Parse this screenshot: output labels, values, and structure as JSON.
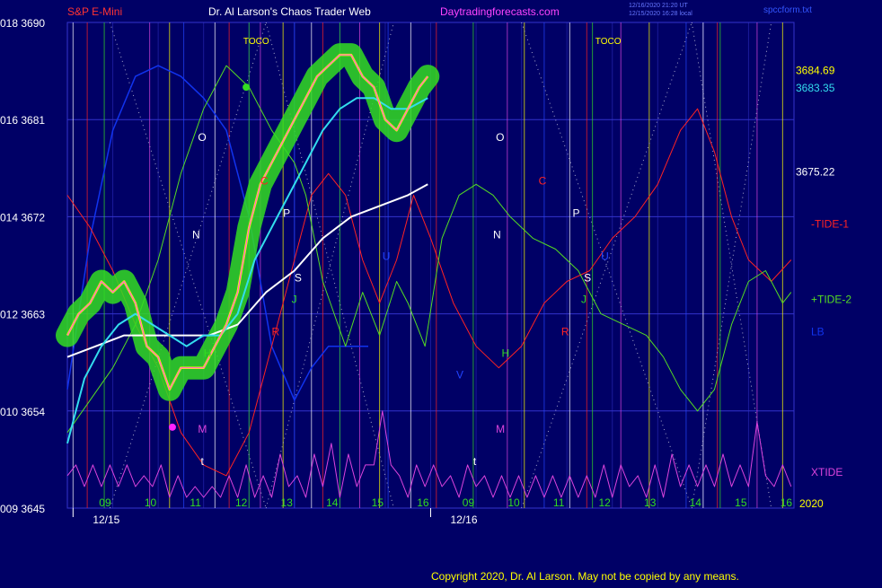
{
  "header": {
    "instrument": "S&P E-Mini",
    "title": "Dr. Al Larson's Chaos Trader Web",
    "site": "Daytradingforecasts.com",
    "timestamp_1": "12/16/2020 21:20 UT",
    "timestamp_2": "12/15/2020 16:28 local",
    "file": "spccform.txt"
  },
  "footer": {
    "copyright": "Copyright 2020, Dr. Al Larson. May not be copied by any means."
  },
  "colors": {
    "background": "#000066",
    "frame": "#3333cc",
    "price": "#ffff00",
    "price_inner": "#ff44ff",
    "glow": "#33dd22",
    "fast_avg": "#33ddee",
    "slow_avg": "#ffffff",
    "tide1": "#ff2222",
    "tide2": "#55dd22",
    "lb": "#1133ee",
    "xtide": "#dd44dd"
  },
  "chart_data": {
    "type": "line",
    "y_axis_left": {
      "ticks": [
        {
          "code": "018",
          "price": "3690"
        },
        {
          "code": "016",
          "price": "3681"
        },
        {
          "code": "014",
          "price": "3672"
        },
        {
          "code": "012",
          "price": "3663"
        },
        {
          "code": "010",
          "price": "3654"
        },
        {
          "code": "009",
          "price": "3645"
        }
      ],
      "range": [
        3645,
        3690
      ]
    },
    "x_axis": {
      "hour_labels": [
        "09",
        "10",
        "11",
        "12",
        "13",
        "14",
        "15",
        "16",
        "09",
        "10",
        "11",
        "12",
        "13",
        "14",
        "15",
        "16"
      ],
      "date_labels": [
        "12/15",
        "12/16"
      ],
      "year": "2020"
    },
    "right_values": {
      "price_last": "3684.69",
      "fast_avg_last": "3683.35",
      "slow_avg_last": "3675.22"
    },
    "series_labels": [
      "-TIDE-1",
      "+TIDE-2",
      "LB",
      "XTIDE"
    ],
    "markers": [
      "TOCO",
      "TOCO"
    ],
    "cycle_letters": [
      {
        "t": "O",
        "c": "#ffffff"
      },
      {
        "t": "N",
        "c": "#ffffff"
      },
      {
        "t": "H",
        "c": "#33dd22"
      },
      {
        "t": "M",
        "c": "#dd44dd"
      },
      {
        "t": "t",
        "c": "#ffffff"
      },
      {
        "t": "C",
        "c": "#ff2222"
      },
      {
        "t": "P",
        "c": "#ffffff"
      },
      {
        "t": "S",
        "c": "#ffffff"
      },
      {
        "t": "J",
        "c": "#33dd22"
      },
      {
        "t": "R",
        "c": "#ff2222"
      },
      {
        "t": "U",
        "c": "#2244ff"
      },
      {
        "t": "V",
        "c": "#2244ff"
      },
      {
        "t": "O",
        "c": "#ffffff"
      },
      {
        "t": "N",
        "c": "#ffffff"
      },
      {
        "t": "H",
        "c": "#33dd22"
      },
      {
        "t": "M",
        "c": "#dd44dd"
      },
      {
        "t": "t",
        "c": "#ffffff"
      },
      {
        "t": "C",
        "c": "#ff2222"
      },
      {
        "t": "P",
        "c": "#ffffff"
      },
      {
        "t": "S",
        "c": "#ffffff"
      },
      {
        "t": "J",
        "c": "#33dd22"
      },
      {
        "t": "R",
        "c": "#ff2222"
      },
      {
        "t": "U",
        "c": "#2244ff"
      }
    ],
    "price_series": [
      [
        0.0,
        3661
      ],
      [
        0.4,
        3663
      ],
      [
        0.8,
        3664
      ],
      [
        1.2,
        3666
      ],
      [
        1.6,
        3665
      ],
      [
        2.0,
        3666
      ],
      [
        2.4,
        3664
      ],
      [
        2.8,
        3660
      ],
      [
        3.2,
        3659
      ],
      [
        3.6,
        3656
      ],
      [
        4.0,
        3658
      ],
      [
        4.4,
        3658
      ],
      [
        4.8,
        3658
      ],
      [
        5.2,
        3660
      ],
      [
        5.6,
        3662
      ],
      [
        6.0,
        3665
      ],
      [
        6.4,
        3671
      ],
      [
        6.8,
        3675
      ],
      [
        7.2,
        3677
      ],
      [
        7.6,
        3679
      ],
      [
        8.0,
        3681
      ],
      [
        8.4,
        3683
      ],
      [
        8.8,
        3685
      ],
      [
        9.2,
        3686
      ],
      [
        9.6,
        3687
      ],
      [
        10.0,
        3687
      ],
      [
        10.4,
        3685
      ],
      [
        10.8,
        3684
      ],
      [
        11.2,
        3681
      ],
      [
        11.6,
        3680
      ],
      [
        12.0,
        3682
      ],
      [
        12.4,
        3684
      ],
      [
        12.7,
        3685
      ]
    ],
    "fast_avg": [
      [
        0.0,
        3651
      ],
      [
        0.6,
        3657
      ],
      [
        1.2,
        3660
      ],
      [
        1.8,
        3662
      ],
      [
        2.4,
        3663
      ],
      [
        3.0,
        3662
      ],
      [
        3.6,
        3661
      ],
      [
        4.2,
        3660
      ],
      [
        4.8,
        3661
      ],
      [
        5.4,
        3661
      ],
      [
        6.0,
        3663
      ],
      [
        6.6,
        3668
      ],
      [
        7.2,
        3671
      ],
      [
        7.8,
        3674
      ],
      [
        8.4,
        3677
      ],
      [
        9.0,
        3680
      ],
      [
        9.6,
        3682
      ],
      [
        10.2,
        3683
      ],
      [
        10.8,
        3683
      ],
      [
        11.4,
        3682
      ],
      [
        12.0,
        3682
      ],
      [
        12.7,
        3683
      ]
    ],
    "slow_avg": [
      [
        0.0,
        3659
      ],
      [
        1.0,
        3660
      ],
      [
        2.0,
        3661
      ],
      [
        3.0,
        3661
      ],
      [
        4.0,
        3661
      ],
      [
        5.0,
        3661
      ],
      [
        6.0,
        3662
      ],
      [
        7.0,
        3665
      ],
      [
        8.0,
        3667
      ],
      [
        9.0,
        3670
      ],
      [
        10.0,
        3672
      ],
      [
        11.0,
        3673
      ],
      [
        12.0,
        3674
      ],
      [
        12.7,
        3675
      ]
    ],
    "tide1": [
      [
        0.0,
        3674
      ],
      [
        0.8,
        3671
      ],
      [
        1.6,
        3667
      ],
      [
        2.4,
        3662
      ],
      [
        3.2,
        3658
      ],
      [
        4.0,
        3652
      ],
      [
        4.8,
        3649
      ],
      [
        5.6,
        3648
      ],
      [
        6.4,
        3652
      ],
      [
        7.2,
        3660
      ],
      [
        8.0,
        3668
      ],
      [
        8.6,
        3674
      ],
      [
        9.2,
        3676
      ],
      [
        9.8,
        3674
      ],
      [
        10.4,
        3668
      ],
      [
        11.0,
        3664
      ],
      [
        11.6,
        3668
      ],
      [
        12.2,
        3674
      ],
      [
        12.8,
        3670
      ],
      [
        13.6,
        3664
      ],
      [
        14.4,
        3660
      ],
      [
        15.2,
        3658
      ],
      [
        16.0,
        3660
      ],
      [
        16.8,
        3664
      ],
      [
        17.6,
        3666
      ],
      [
        18.4,
        3667
      ],
      [
        19.2,
        3670
      ],
      [
        20.0,
        3672
      ],
      [
        20.8,
        3675
      ],
      [
        21.6,
        3680
      ],
      [
        22.2,
        3682
      ],
      [
        22.8,
        3678
      ],
      [
        23.4,
        3672
      ],
      [
        24.0,
        3668
      ],
      [
        24.8,
        3666
      ],
      [
        25.5,
        3668
      ]
    ],
    "tide2": [
      [
        0.0,
        3652
      ],
      [
        0.8,
        3655
      ],
      [
        1.6,
        3658
      ],
      [
        2.4,
        3662
      ],
      [
        3.2,
        3668
      ],
      [
        4.0,
        3676
      ],
      [
        4.8,
        3682
      ],
      [
        5.6,
        3686
      ],
      [
        6.4,
        3684
      ],
      [
        7.2,
        3680
      ],
      [
        8.0,
        3677
      ],
      [
        8.4,
        3674
      ],
      [
        9.0,
        3666
      ],
      [
        9.8,
        3660
      ],
      [
        10.4,
        3665
      ],
      [
        11.0,
        3661
      ],
      [
        11.6,
        3666
      ],
      [
        12.0,
        3664
      ],
      [
        12.6,
        3660
      ],
      [
        13.2,
        3670
      ],
      [
        13.8,
        3674
      ],
      [
        14.4,
        3675
      ],
      [
        15.0,
        3674
      ],
      [
        15.6,
        3672
      ],
      [
        16.4,
        3670
      ],
      [
        17.2,
        3669
      ],
      [
        18.0,
        3667
      ],
      [
        18.8,
        3663
      ],
      [
        19.6,
        3662
      ],
      [
        20.4,
        3661
      ],
      [
        21.0,
        3659
      ],
      [
        21.6,
        3656
      ],
      [
        22.2,
        3654
      ],
      [
        22.8,
        3656
      ],
      [
        23.4,
        3662
      ],
      [
        24.0,
        3666
      ],
      [
        24.6,
        3667
      ],
      [
        25.2,
        3664
      ],
      [
        25.5,
        3665
      ]
    ],
    "lb": [
      [
        0.0,
        3656
      ],
      [
        0.8,
        3670
      ],
      [
        1.6,
        3680
      ],
      [
        2.4,
        3685
      ],
      [
        3.2,
        3686
      ],
      [
        4.0,
        3685
      ],
      [
        4.8,
        3683
      ],
      [
        5.6,
        3680
      ],
      [
        6.4,
        3672
      ],
      [
        7.2,
        3660
      ],
      [
        8.0,
        3655
      ],
      [
        8.6,
        3658
      ],
      [
        9.2,
        3660
      ],
      [
        10.0,
        3660
      ],
      [
        10.6,
        3660
      ]
    ],
    "xtide": [
      [
        0.0,
        3648
      ],
      [
        0.3,
        3649
      ],
      [
        0.6,
        3647
      ],
      [
        0.9,
        3649
      ],
      [
        1.2,
        3647
      ],
      [
        1.5,
        3649
      ],
      [
        1.8,
        3647
      ],
      [
        2.1,
        3649
      ],
      [
        2.4,
        3647
      ],
      [
        2.7,
        3648
      ],
      [
        3.0,
        3647
      ],
      [
        3.3,
        3649
      ],
      [
        3.6,
        3646
      ],
      [
        3.9,
        3648
      ],
      [
        4.2,
        3646
      ],
      [
        4.5,
        3647
      ],
      [
        4.8,
        3646
      ],
      [
        5.1,
        3647
      ],
      [
        5.4,
        3646
      ],
      [
        5.7,
        3648
      ],
      [
        6.0,
        3646
      ],
      [
        6.3,
        3649
      ],
      [
        6.6,
        3646
      ],
      [
        6.9,
        3648
      ],
      [
        7.2,
        3646
      ],
      [
        7.5,
        3650
      ],
      [
        7.8,
        3647
      ],
      [
        8.1,
        3648
      ],
      [
        8.4,
        3646
      ],
      [
        8.7,
        3650
      ],
      [
        9.0,
        3647
      ],
      [
        9.3,
        3651
      ],
      [
        9.6,
        3646
      ],
      [
        9.9,
        3650
      ],
      [
        10.2,
        3647
      ],
      [
        10.5,
        3649
      ],
      [
        10.8,
        3649
      ],
      [
        11.1,
        3654
      ],
      [
        11.4,
        3649
      ],
      [
        11.7,
        3648
      ],
      [
        12.0,
        3646
      ],
      [
        12.3,
        3649
      ],
      [
        12.6,
        3647
      ],
      [
        12.9,
        3649
      ],
      [
        13.2,
        3647
      ],
      [
        13.5,
        3648
      ],
      [
        13.8,
        3646
      ],
      [
        14.1,
        3649
      ],
      [
        14.4,
        3647
      ],
      [
        14.7,
        3648
      ],
      [
        15.0,
        3646
      ],
      [
        15.3,
        3648
      ],
      [
        15.6,
        3646
      ],
      [
        15.9,
        3648
      ],
      [
        16.2,
        3646
      ],
      [
        16.5,
        3648
      ],
      [
        16.8,
        3646
      ],
      [
        17.1,
        3648
      ],
      [
        17.4,
        3646
      ],
      [
        17.7,
        3648
      ],
      [
        18.0,
        3646
      ],
      [
        18.3,
        3648
      ],
      [
        18.6,
        3646
      ],
      [
        18.9,
        3649
      ],
      [
        19.2,
        3646
      ],
      [
        19.5,
        3649
      ],
      [
        19.8,
        3647
      ],
      [
        20.1,
        3648
      ],
      [
        20.4,
        3646
      ],
      [
        20.7,
        3649
      ],
      [
        21.0,
        3646
      ],
      [
        21.3,
        3650
      ],
      [
        21.6,
        3647
      ],
      [
        21.9,
        3649
      ],
      [
        22.2,
        3647
      ],
      [
        22.5,
        3649
      ],
      [
        22.8,
        3647
      ],
      [
        23.1,
        3650
      ],
      [
        23.4,
        3647
      ],
      [
        23.7,
        3649
      ],
      [
        24.0,
        3647
      ],
      [
        24.3,
        3653
      ],
      [
        24.6,
        3648
      ],
      [
        24.9,
        3647
      ],
      [
        25.2,
        3649
      ],
      [
        25.5,
        3647
      ]
    ],
    "cycle_markers_x": [
      0.2,
      0.7,
      1.3,
      2.9,
      3.6,
      4.1,
      5.2,
      5.7,
      6.4,
      6.8,
      7.6,
      8.0,
      8.6,
      9.0,
      9.6,
      10.3,
      11.0,
      11.3,
      12.1,
      13.0,
      14.3,
      15.5,
      16.1,
      16.8,
      17.7,
      18.3,
      18.5,
      19.5,
      20.5,
      21.8,
      22.4,
      22.9,
      23.0,
      24.3,
      25.2
    ],
    "y_label_dummy": ""
  }
}
